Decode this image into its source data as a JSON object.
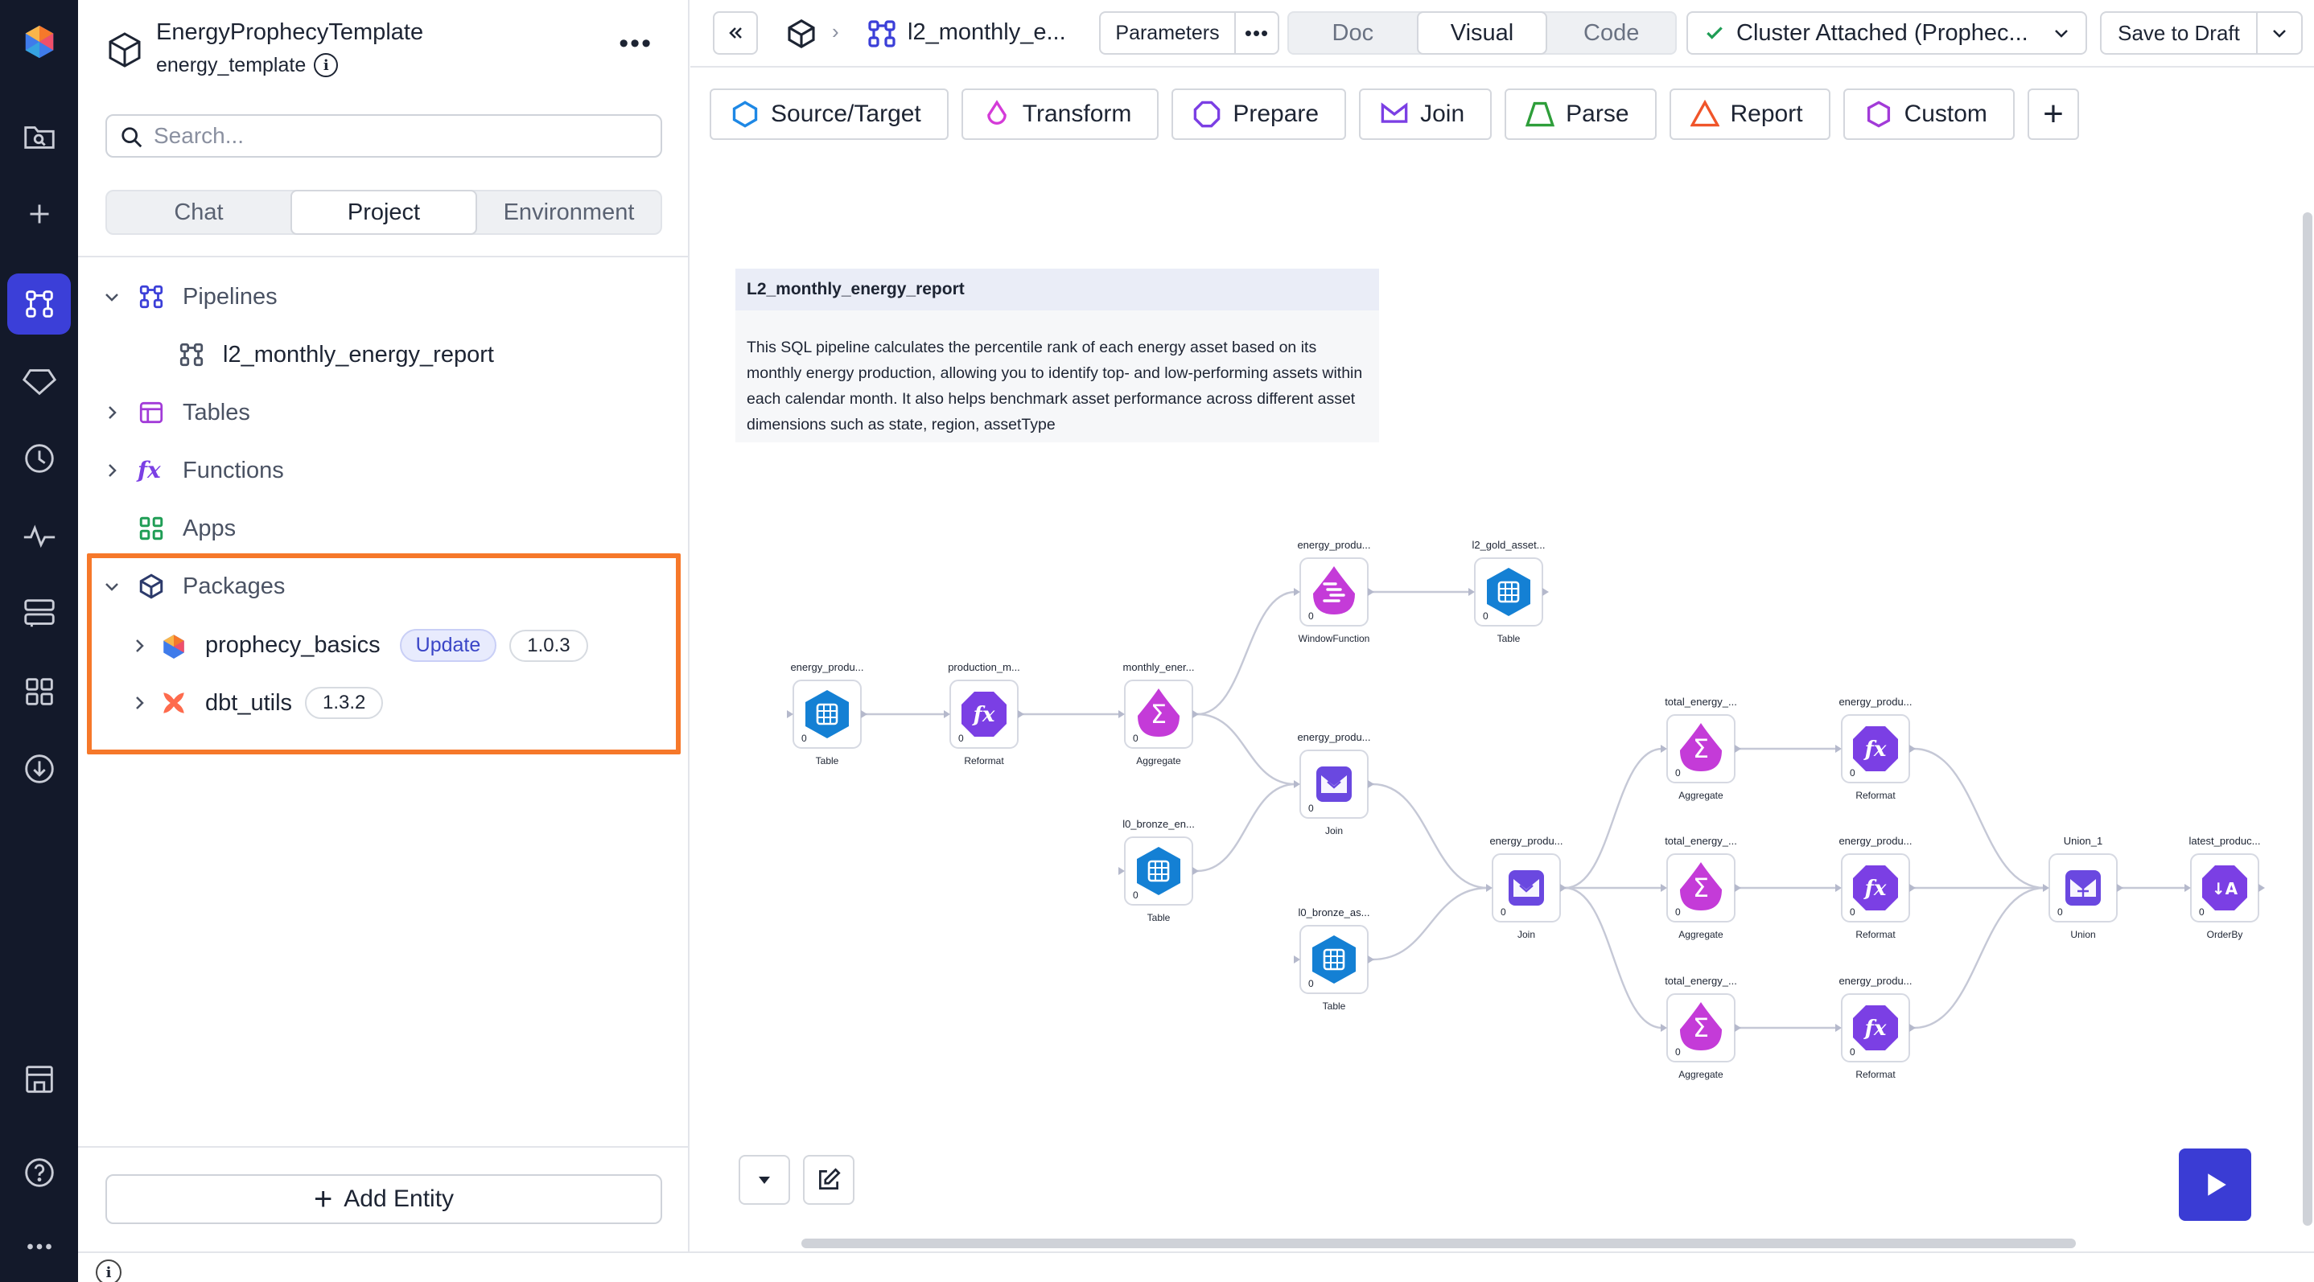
{
  "rail": {
    "items": [
      "logo-icon",
      "folder-search-icon",
      "plus-icon",
      "pipeline-icon",
      "gem-icon",
      "history-icon",
      "pulse-icon",
      "monitor-icon",
      "apps-grid-icon",
      "download-icon",
      "store-icon",
      "help-icon",
      "more-icon"
    ],
    "active": "pipeline-icon"
  },
  "project": {
    "title": "EnergyProphecyTemplate",
    "subtitle": "energy_template",
    "search_placeholder": "Search...",
    "tabs": [
      "Chat",
      "Project",
      "Environment"
    ],
    "active_tab": "Project"
  },
  "tree": {
    "pipelines": {
      "label": "Pipelines",
      "child": "l2_monthly_energy_report"
    },
    "tables": "Tables",
    "functions": "Functions",
    "apps": "Apps",
    "packages": {
      "label": "Packages",
      "items": [
        {
          "name": "prophecy_basics",
          "update": "Update",
          "version": "1.0.3"
        },
        {
          "name": "dbt_utils",
          "version": "1.3.2"
        }
      ]
    }
  },
  "add_entity": "Add Entity",
  "topbar": {
    "pipeline_name": "l2_monthly_e...",
    "parameters": "Parameters",
    "views": [
      "Doc",
      "Visual",
      "Code"
    ],
    "active_view": "Visual",
    "cluster": "Cluster Attached (Prophec...",
    "save": "Save to Draft"
  },
  "gem_categories": [
    {
      "label": "Source/Target",
      "color": "#1e88e5"
    },
    {
      "label": "Transform",
      "color": "#d43bd8"
    },
    {
      "label": "Prepare",
      "color": "#7b3fe4"
    },
    {
      "label": "Join",
      "color": "#7b3fe4"
    },
    {
      "label": "Parse",
      "color": "#2e9e3a"
    },
    {
      "label": "Report",
      "color": "#f0552a"
    },
    {
      "label": "Custom",
      "color": "#a23bd8"
    }
  ],
  "description": {
    "title": "L2_monthly_energy_report",
    "body": "This SQL pipeline calculates the percentile rank of each energy asset based on its monthly energy production, allowing you to identify top- and low-performing assets within each calendar month. It also helps benchmark asset performance across different asset dimensions such as state, region, assetType"
  },
  "graph": {
    "nodes": [
      {
        "id": "n1",
        "title": "energy_produ...",
        "type": "Table",
        "kind": "table"
      },
      {
        "id": "n2",
        "title": "production_m...",
        "type": "Reformat",
        "kind": "reformat"
      },
      {
        "id": "n3",
        "title": "monthly_ener...",
        "type": "Aggregate",
        "kind": "aggregate"
      },
      {
        "id": "n4",
        "title": "energy_produ...",
        "type": "WindowFunction",
        "kind": "window"
      },
      {
        "id": "n5",
        "title": "l2_gold_asset...",
        "type": "Table",
        "kind": "table"
      },
      {
        "id": "n6",
        "title": "energy_produ...",
        "type": "Join",
        "kind": "join"
      },
      {
        "id": "n7",
        "title": "l0_bronze_en...",
        "type": "Table",
        "kind": "table"
      },
      {
        "id": "n8",
        "title": "l0_bronze_as...",
        "type": "Table",
        "kind": "table"
      },
      {
        "id": "n9",
        "title": "energy_produ...",
        "type": "Join",
        "kind": "join"
      },
      {
        "id": "n10",
        "title": "total_energy_...",
        "type": "Aggregate",
        "kind": "aggregate"
      },
      {
        "id": "n11",
        "title": "total_energy_...",
        "type": "Aggregate",
        "kind": "aggregate"
      },
      {
        "id": "n12",
        "title": "total_energy_...",
        "type": "Aggregate",
        "kind": "aggregate"
      },
      {
        "id": "n13",
        "title": "energy_produ...",
        "type": "Reformat",
        "kind": "reformat"
      },
      {
        "id": "n14",
        "title": "energy_produ...",
        "type": "Reformat",
        "kind": "reformat"
      },
      {
        "id": "n15",
        "title": "energy_produ...",
        "type": "Reformat",
        "kind": "reformat"
      },
      {
        "id": "n16",
        "title": "Union_1",
        "type": "Union",
        "kind": "union"
      },
      {
        "id": "n17",
        "title": "latest_produc...",
        "type": "OrderBy",
        "kind": "orderby"
      }
    ],
    "edges": [
      [
        "n1",
        "n2"
      ],
      [
        "n2",
        "n3"
      ],
      [
        "n3",
        "n4"
      ],
      [
        "n4",
        "n5"
      ],
      [
        "n3",
        "n6"
      ],
      [
        "n7",
        "n6"
      ],
      [
        "n6",
        "n9"
      ],
      [
        "n8",
        "n9"
      ],
      [
        "n9",
        "n10"
      ],
      [
        "n9",
        "n11"
      ],
      [
        "n9",
        "n12"
      ],
      [
        "n10",
        "n13"
      ],
      [
        "n11",
        "n14"
      ],
      [
        "n12",
        "n15"
      ],
      [
        "n13",
        "n16"
      ],
      [
        "n14",
        "n16"
      ],
      [
        "n15",
        "n16"
      ],
      [
        "n16",
        "n17"
      ]
    ],
    "port_label": "0"
  }
}
